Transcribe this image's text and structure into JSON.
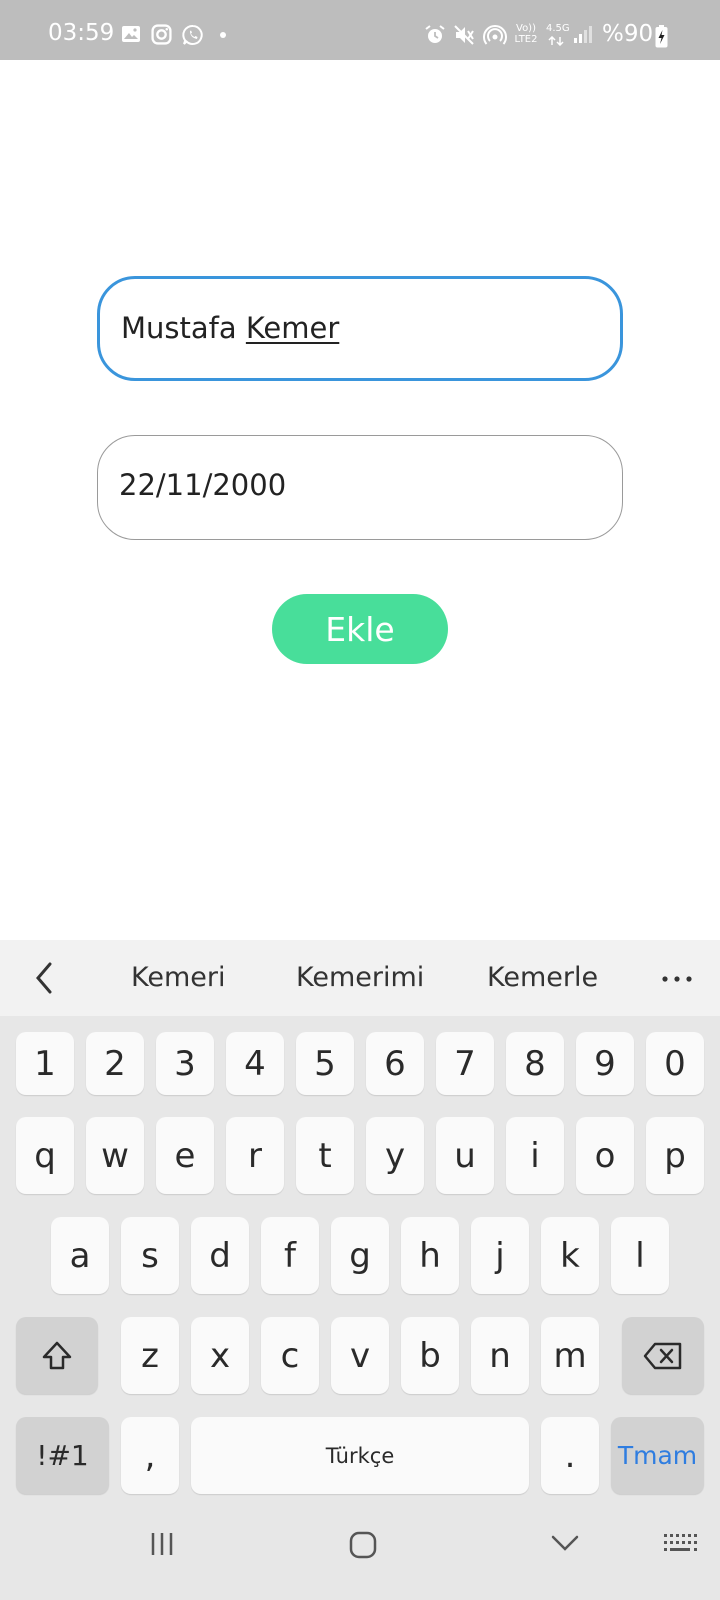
{
  "status_bar": {
    "time": "03:59",
    "left_icons": [
      "gallery-icon",
      "instagram-icon",
      "whatsapp-icon",
      "dot-icon"
    ],
    "right_icons": [
      "alarm-icon",
      "mute-icon",
      "hotspot-icon",
      "volte-icon",
      "data-4g-icon",
      "signal-icon",
      "battery-charging-icon"
    ],
    "volte_label": "Vo)) LTE2",
    "network_label": "4.5G",
    "battery_text": "%90"
  },
  "form": {
    "name_value_prefix": "Mustafa ",
    "name_value_composing": "Kemer",
    "date_value": "22/11/2000",
    "add_button_label": "Ekle",
    "accent": "#48de9a",
    "focus_color": "#3a95dc"
  },
  "keyboard": {
    "suggestions": [
      "Kemeri",
      "Kemerimi",
      "Kemerle"
    ],
    "number_row": [
      "1",
      "2",
      "3",
      "4",
      "5",
      "6",
      "7",
      "8",
      "9",
      "0"
    ],
    "row1": [
      "q",
      "w",
      "e",
      "r",
      "t",
      "y",
      "u",
      "i",
      "o",
      "p"
    ],
    "row2": [
      "a",
      "s",
      "d",
      "f",
      "g",
      "h",
      "j",
      "k",
      "l"
    ],
    "row3": [
      "z",
      "x",
      "c",
      "v",
      "b",
      "n",
      "m"
    ],
    "symbols_label": "!#1",
    "comma_label": ",",
    "space_label": "Türkçe",
    "period_label": ".",
    "done_label": "Tmam",
    "done_color": "#2f7de0"
  }
}
